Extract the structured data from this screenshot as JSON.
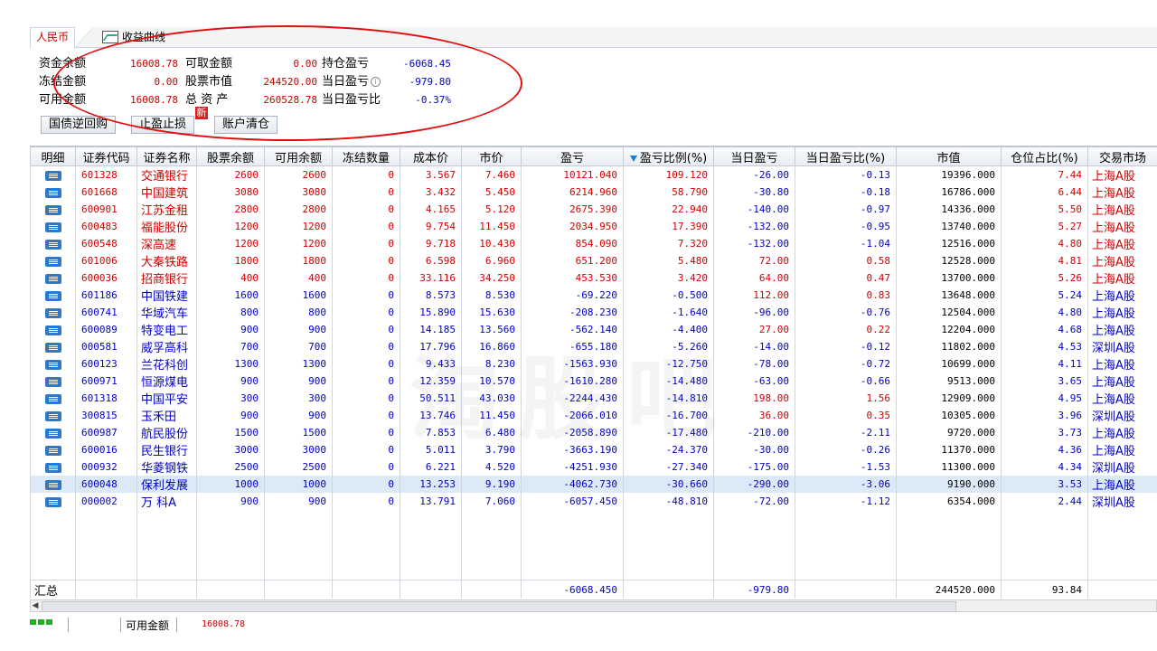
{
  "tabs": {
    "cny": "人民币",
    "curve": "收益曲线"
  },
  "summary": {
    "cash_balance_label": "资金余额",
    "cash_balance": "16008.78",
    "withdrawable_label": "可取金额",
    "withdrawable": "0.00",
    "position_pl_label": "持仓盈亏",
    "position_pl": "-6068.45",
    "frozen_label": "冻结金额",
    "frozen": "0.00",
    "stock_mv_label": "股票市值",
    "stock_mv": "244520.00",
    "daily_pl_label": "当日盈亏",
    "daily_pl": "-979.80",
    "available_label": "可用金额",
    "available": "16008.78",
    "total_assets_label": "总 资 产",
    "total_assets": "260528.78",
    "daily_pl_ratio_label": "当日盈亏比",
    "daily_pl_ratio": "-0.37%"
  },
  "buttons": {
    "repo": "国债逆回购",
    "tp_sl": "止盈止损",
    "new_badge": "新",
    "clear": "账户清仓"
  },
  "table": {
    "headers": [
      "明细",
      "证券代码",
      "证券名称",
      "股票余额",
      "可用余额",
      "冻结数量",
      "成本价",
      "市价",
      "盈亏",
      "盈亏比例(%)",
      "当日盈亏",
      "当日盈亏比(%)",
      "市值",
      "仓位占比(%)",
      "交易市场"
    ],
    "rows": [
      [
        "601328",
        "交通银行",
        "2600",
        "2600",
        "0",
        "3.567",
        "7.460",
        "10121.040",
        "109.120",
        "-26.00",
        "-0.13",
        "19396.000",
        "7.44",
        "上海A股"
      ],
      [
        "601668",
        "中国建筑",
        "3080",
        "3080",
        "0",
        "3.432",
        "5.450",
        "6214.960",
        "58.790",
        "-30.80",
        "-0.18",
        "16786.000",
        "6.44",
        "上海A股"
      ],
      [
        "600901",
        "江苏金租",
        "2800",
        "2800",
        "0",
        "4.165",
        "5.120",
        "2675.390",
        "22.940",
        "-140.00",
        "-0.97",
        "14336.000",
        "5.50",
        "上海A股"
      ],
      [
        "600483",
        "福能股份",
        "1200",
        "1200",
        "0",
        "9.754",
        "11.450",
        "2034.950",
        "17.390",
        "-132.00",
        "-0.95",
        "13740.000",
        "5.27",
        "上海A股"
      ],
      [
        "600548",
        "深高速",
        "1200",
        "1200",
        "0",
        "9.718",
        "10.430",
        "854.090",
        "7.320",
        "-132.00",
        "-1.04",
        "12516.000",
        "4.80",
        "上海A股"
      ],
      [
        "601006",
        "大秦铁路",
        "1800",
        "1800",
        "0",
        "6.598",
        "6.960",
        "651.200",
        "5.480",
        "72.00",
        "0.58",
        "12528.000",
        "4.81",
        "上海A股"
      ],
      [
        "600036",
        "招商银行",
        "400",
        "400",
        "0",
        "33.116",
        "34.250",
        "453.530",
        "3.420",
        "64.00",
        "0.47",
        "13700.000",
        "5.26",
        "上海A股"
      ],
      [
        "601186",
        "中国铁建",
        "1600",
        "1600",
        "0",
        "8.573",
        "8.530",
        "-69.220",
        "-0.500",
        "112.00",
        "0.83",
        "13648.000",
        "5.24",
        "上海A股"
      ],
      [
        "600741",
        "华域汽车",
        "800",
        "800",
        "0",
        "15.890",
        "15.630",
        "-208.230",
        "-1.640",
        "-96.00",
        "-0.76",
        "12504.000",
        "4.80",
        "上海A股"
      ],
      [
        "600089",
        "特变电工",
        "900",
        "900",
        "0",
        "14.185",
        "13.560",
        "-562.140",
        "-4.400",
        "27.00",
        "0.22",
        "12204.000",
        "4.68",
        "上海A股"
      ],
      [
        "000581",
        "威孚高科",
        "700",
        "700",
        "0",
        "17.796",
        "16.860",
        "-655.180",
        "-5.260",
        "-14.00",
        "-0.12",
        "11802.000",
        "4.53",
        "深圳A股"
      ],
      [
        "600123",
        "兰花科创",
        "1300",
        "1300",
        "0",
        "9.433",
        "8.230",
        "-1563.930",
        "-12.750",
        "-78.00",
        "-0.72",
        "10699.000",
        "4.11",
        "上海A股"
      ],
      [
        "600971",
        "恒源煤电",
        "900",
        "900",
        "0",
        "12.359",
        "10.570",
        "-1610.280",
        "-14.480",
        "-63.00",
        "-0.66",
        "9513.000",
        "3.65",
        "上海A股"
      ],
      [
        "601318",
        "中国平安",
        "300",
        "300",
        "0",
        "50.511",
        "43.030",
        "-2244.430",
        "-14.810",
        "198.00",
        "1.56",
        "12909.000",
        "4.95",
        "上海A股"
      ],
      [
        "300815",
        "玉禾田",
        "900",
        "900",
        "0",
        "13.746",
        "11.450",
        "-2066.010",
        "-16.700",
        "36.00",
        "0.35",
        "10305.000",
        "3.96",
        "深圳A股"
      ],
      [
        "600987",
        "航民股份",
        "1500",
        "1500",
        "0",
        "7.853",
        "6.480",
        "-2058.890",
        "-17.480",
        "-210.00",
        "-2.11",
        "9720.000",
        "3.73",
        "上海A股"
      ],
      [
        "600016",
        "民生银行",
        "3000",
        "3000",
        "0",
        "5.011",
        "3.790",
        "-3663.190",
        "-24.370",
        "-30.00",
        "-0.26",
        "11370.000",
        "4.36",
        "上海A股"
      ],
      [
        "000932",
        "华菱钢铁",
        "2500",
        "2500",
        "0",
        "6.221",
        "4.520",
        "-4251.930",
        "-27.340",
        "-175.00",
        "-1.53",
        "11300.000",
        "4.34",
        "深圳A股"
      ],
      [
        "600048",
        "保利发展",
        "1000",
        "1000",
        "0",
        "13.253",
        "9.190",
        "-4062.730",
        "-30.660",
        "-290.00",
        "-3.06",
        "9190.000",
        "3.53",
        "上海A股"
      ],
      [
        "000002",
        "万 科A",
        "900",
        "900",
        "0",
        "13.791",
        "7.060",
        "-6057.450",
        "-48.810",
        "-72.00",
        "-1.12",
        "6354.000",
        "2.44",
        "深圳A股"
      ]
    ],
    "totals": {
      "label": "汇总",
      "pl": "-6068.450",
      "daily_pl": "-979.80",
      "mv": "244520.000",
      "ratio": "93.84"
    }
  },
  "watermark": "淘股吧",
  "status": {
    "available_label": "可用金额",
    "available": "16008.78"
  },
  "colors": {
    "profit": "#d00000",
    "loss": "#0000c8",
    "accent": "#e01010",
    "selected_row": "#dceaf8"
  }
}
